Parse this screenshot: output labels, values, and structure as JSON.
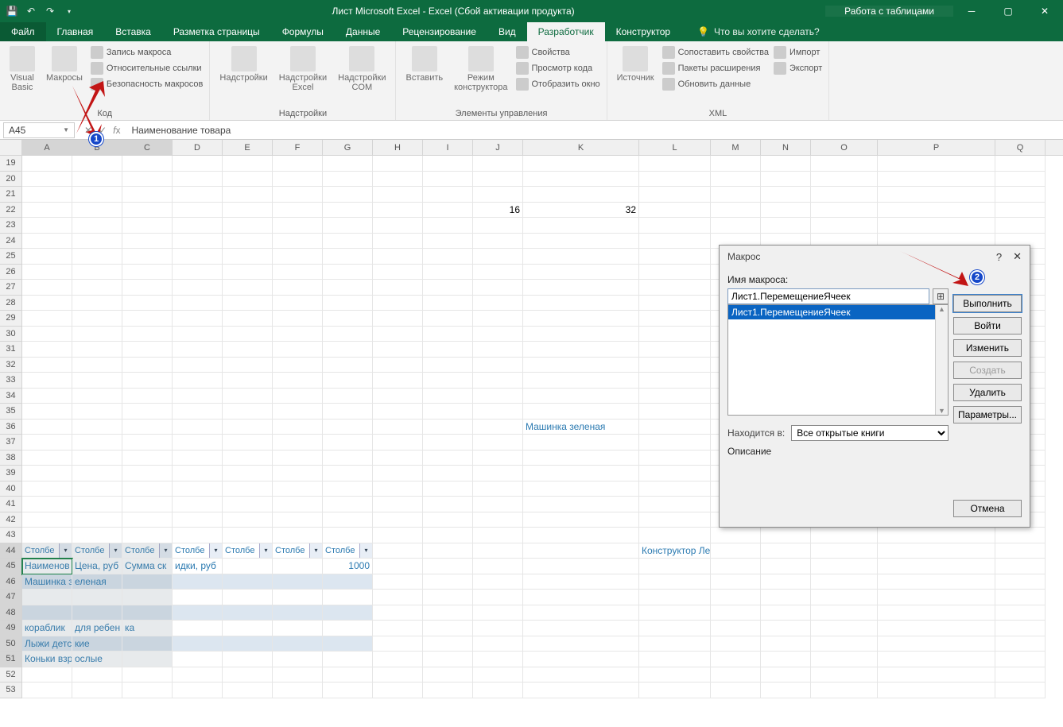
{
  "title": "Лист Microsoft Excel - Excel (Сбой активации продукта)",
  "context_tab_group": "Работа с таблицами",
  "tabs": [
    "Файл",
    "Главная",
    "Вставка",
    "Разметка страницы",
    "Формулы",
    "Данные",
    "Рецензирование",
    "Вид",
    "Разработчик",
    "Конструктор"
  ],
  "active_tab": "Разработчик",
  "tell_me": "Что вы хотите сделать?",
  "ribbon": {
    "g_code": {
      "label": "Код",
      "vb": "Visual\nBasic",
      "macros": "Макросы",
      "record": "Запись макроса",
      "relative": "Относительные ссылки",
      "security": "Безопасность макросов"
    },
    "g_addins": {
      "label": "Надстройки",
      "add": "Надстройки",
      "add_excel": "Надстройки\nExcel",
      "add_com": "Надстройки\nCOM"
    },
    "g_controls": {
      "label": "Элементы управления",
      "insert": "Вставить",
      "design": "Режим\nконструктора",
      "props": "Свойства",
      "view_code": "Просмотр кода",
      "show_window": "Отобразить окно"
    },
    "g_xml": {
      "label": "XML",
      "source": "Источник",
      "map_props": "Сопоставить свойства",
      "exp_packs": "Пакеты расширения",
      "refresh": "Обновить данные",
      "import": "Импорт",
      "export": "Экспорт"
    }
  },
  "namebox": "A45",
  "formula": "Наименование товара",
  "columns": [
    "A",
    "B",
    "C",
    "D",
    "E",
    "F",
    "G",
    "H",
    "I",
    "J",
    "K",
    "L",
    "M",
    "N",
    "O",
    "P",
    "Q"
  ],
  "first_row": 19,
  "last_row": 53,
  "cells": {
    "J22": "16",
    "K22": "32",
    "K36": "Машинка зеленая",
    "L44": "Конструктор Лего",
    "A44": "Столбе",
    "B44": "Столбе",
    "C44": "Столбе",
    "D44": "Столбе",
    "E44": "Столбе",
    "F44": "Столбе",
    "G44": "Столбе",
    "A45": "Наименов",
    "B45": "Цена, руб",
    "C45": "Сумма ск",
    "D45": "идки, руб",
    "G45": "1000",
    "A46": "Машинка з",
    "B46": "еленая",
    "A49": "кораблик ",
    "B49": "для ребен",
    "C49": "ка",
    "A50": "Лыжи детс",
    "B50": "кие",
    "A51": "Коньки взр",
    "B51": "ослые"
  },
  "selected_cols": [
    "A",
    "B",
    "C"
  ],
  "selected_rows": [
    44,
    45,
    46,
    47,
    48,
    49,
    50,
    51
  ],
  "active_cell": "A45",
  "dialog": {
    "title": "Макрос",
    "name_label": "Имя макроса:",
    "name_value": "Лист1.ПеремещениеЯчеек",
    "list_item": "Лист1.ПеремещениеЯчеек",
    "btn_run": "Выполнить",
    "btn_step": "Войти",
    "btn_edit": "Изменить",
    "btn_create": "Создать",
    "btn_delete": "Удалить",
    "btn_options": "Параметры...",
    "location_label": "Находится в:",
    "location_value": "Все открытые книги",
    "desc_label": "Описание",
    "btn_cancel": "Отмена"
  },
  "callouts": {
    "c1": "1",
    "c2": "2"
  }
}
